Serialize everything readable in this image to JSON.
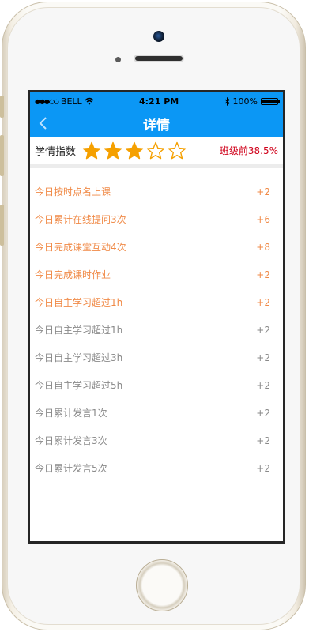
{
  "status_bar": {
    "carrier": "BELL",
    "time": "4:21 PM",
    "battery": "100%"
  },
  "navbar": {
    "title": "详情",
    "back_icon": "chevron-left-icon"
  },
  "rating": {
    "label": "学情指数",
    "stars_filled": 3,
    "stars_total": 5,
    "rank_text": "班级前38.5%"
  },
  "items": [
    {
      "label": "今日按时点名上课",
      "points": "+2",
      "completed": true
    },
    {
      "label": "今日累计在线提问3次",
      "points": "+6",
      "completed": true
    },
    {
      "label": "今日完成课堂互动4次",
      "points": "+8",
      "completed": true
    },
    {
      "label": "今日完成课时作业",
      "points": "+2",
      "completed": true
    },
    {
      "label": "今日自主学习超过1h",
      "points": "+2",
      "completed": true
    },
    {
      "label": "今日自主学习超过1h",
      "points": "+2",
      "completed": false
    },
    {
      "label": "今日自主学习超过3h",
      "points": "+2",
      "completed": false
    },
    {
      "label": "今日自主学习超过5h",
      "points": "+2",
      "completed": false
    },
    {
      "label": "今日累计发言1次",
      "points": "+2",
      "completed": false
    },
    {
      "label": "今日累计发言3次",
      "points": "+2",
      "completed": false
    },
    {
      "label": "今日累计发言5次",
      "points": "+2",
      "completed": false
    }
  ],
  "colors": {
    "accent": "#0b97f5",
    "completed": "#f08a47",
    "pending": "#8a8a8a",
    "rank": "#d0021b",
    "star": "#f5a000"
  }
}
